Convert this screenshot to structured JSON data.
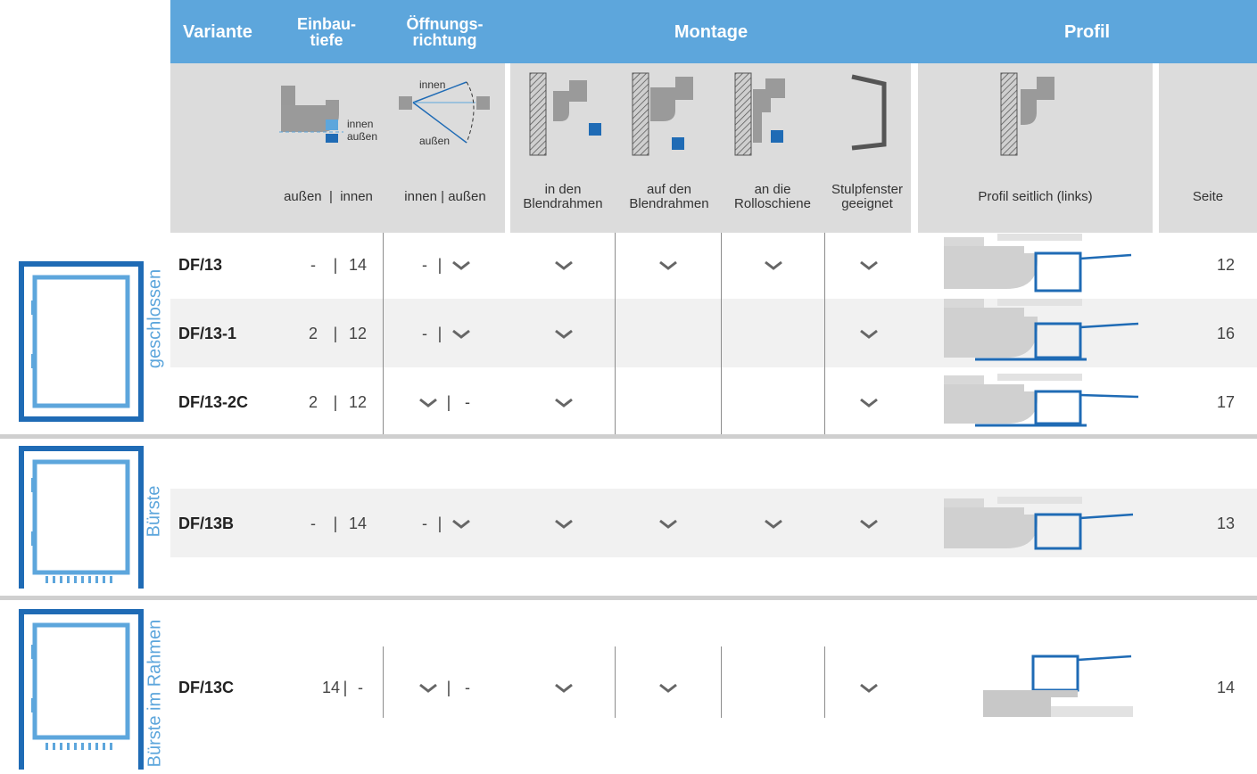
{
  "header": {
    "variante": "Variante",
    "einbau_1": "Einbau-",
    "einbau_2": "tiefe",
    "oeff_1": "Öffnungs-",
    "oeff_2": "richtung",
    "montage": "Montage",
    "profil": "Profil"
  },
  "diagram_labels": {
    "innen": "innen",
    "aussen": "außen",
    "innen2": "innen",
    "aussen2": "außen"
  },
  "subheader": {
    "einbau": "außen  |  innen",
    "oeff": "innen | außen",
    "montage_1_a": "in den",
    "montage_1_b": "Blendrahmen",
    "montage_2_a": "auf den",
    "montage_2_b": "Blendrahmen",
    "montage_3_a": "an die",
    "montage_3_b": "Rolloschiene",
    "montage_4_a": "Stulpfenster",
    "montage_4_b": "geeignet",
    "profil": "Profil seitlich (links)",
    "seite": "Seite"
  },
  "groups": [
    {
      "label": "geschlossen"
    },
    {
      "label": "Bürste"
    },
    {
      "label": "Bürste im Rahmen"
    }
  ],
  "rows": [
    {
      "name": "DF/13",
      "einbau_a": "-",
      "einbau_b": "14",
      "oeff_a": "-",
      "oeff_b_check": true,
      "m1": true,
      "m2": true,
      "m3": true,
      "m4": true,
      "seite": "12"
    },
    {
      "name": "DF/13-1",
      "einbau_a": "2",
      "einbau_b": "12",
      "oeff_a": "-",
      "oeff_b_check": true,
      "m1": true,
      "m2": false,
      "m3": false,
      "m4": true,
      "seite": "16"
    },
    {
      "name": "DF/13-2C",
      "einbau_a": "2",
      "einbau_b": "12",
      "oeff_a_check": true,
      "oeff_b": "-",
      "m1": true,
      "m2": false,
      "m3": false,
      "m4": true,
      "seite": "17"
    },
    {
      "name": "DF/13B",
      "einbau_a": "-",
      "einbau_b": "14",
      "oeff_a": "-",
      "oeff_b_check": true,
      "m1": true,
      "m2": true,
      "m3": true,
      "m4": true,
      "seite": "13"
    },
    {
      "name": "DF/13C",
      "einbau_a": "14",
      "einbau_b": "-",
      "oeff_a_check": true,
      "oeff_b": "-",
      "m1": true,
      "m2": true,
      "m3": false,
      "m4": true,
      "seite": "14"
    }
  ],
  "colors": {
    "header_bg": "#5da6dc",
    "accent_blue": "#1f6bb5",
    "light_blue": "#5da6dc",
    "subheader_bg": "#dcdcdc",
    "row_alt_bg": "#f1f1f1",
    "check": "#666666"
  }
}
